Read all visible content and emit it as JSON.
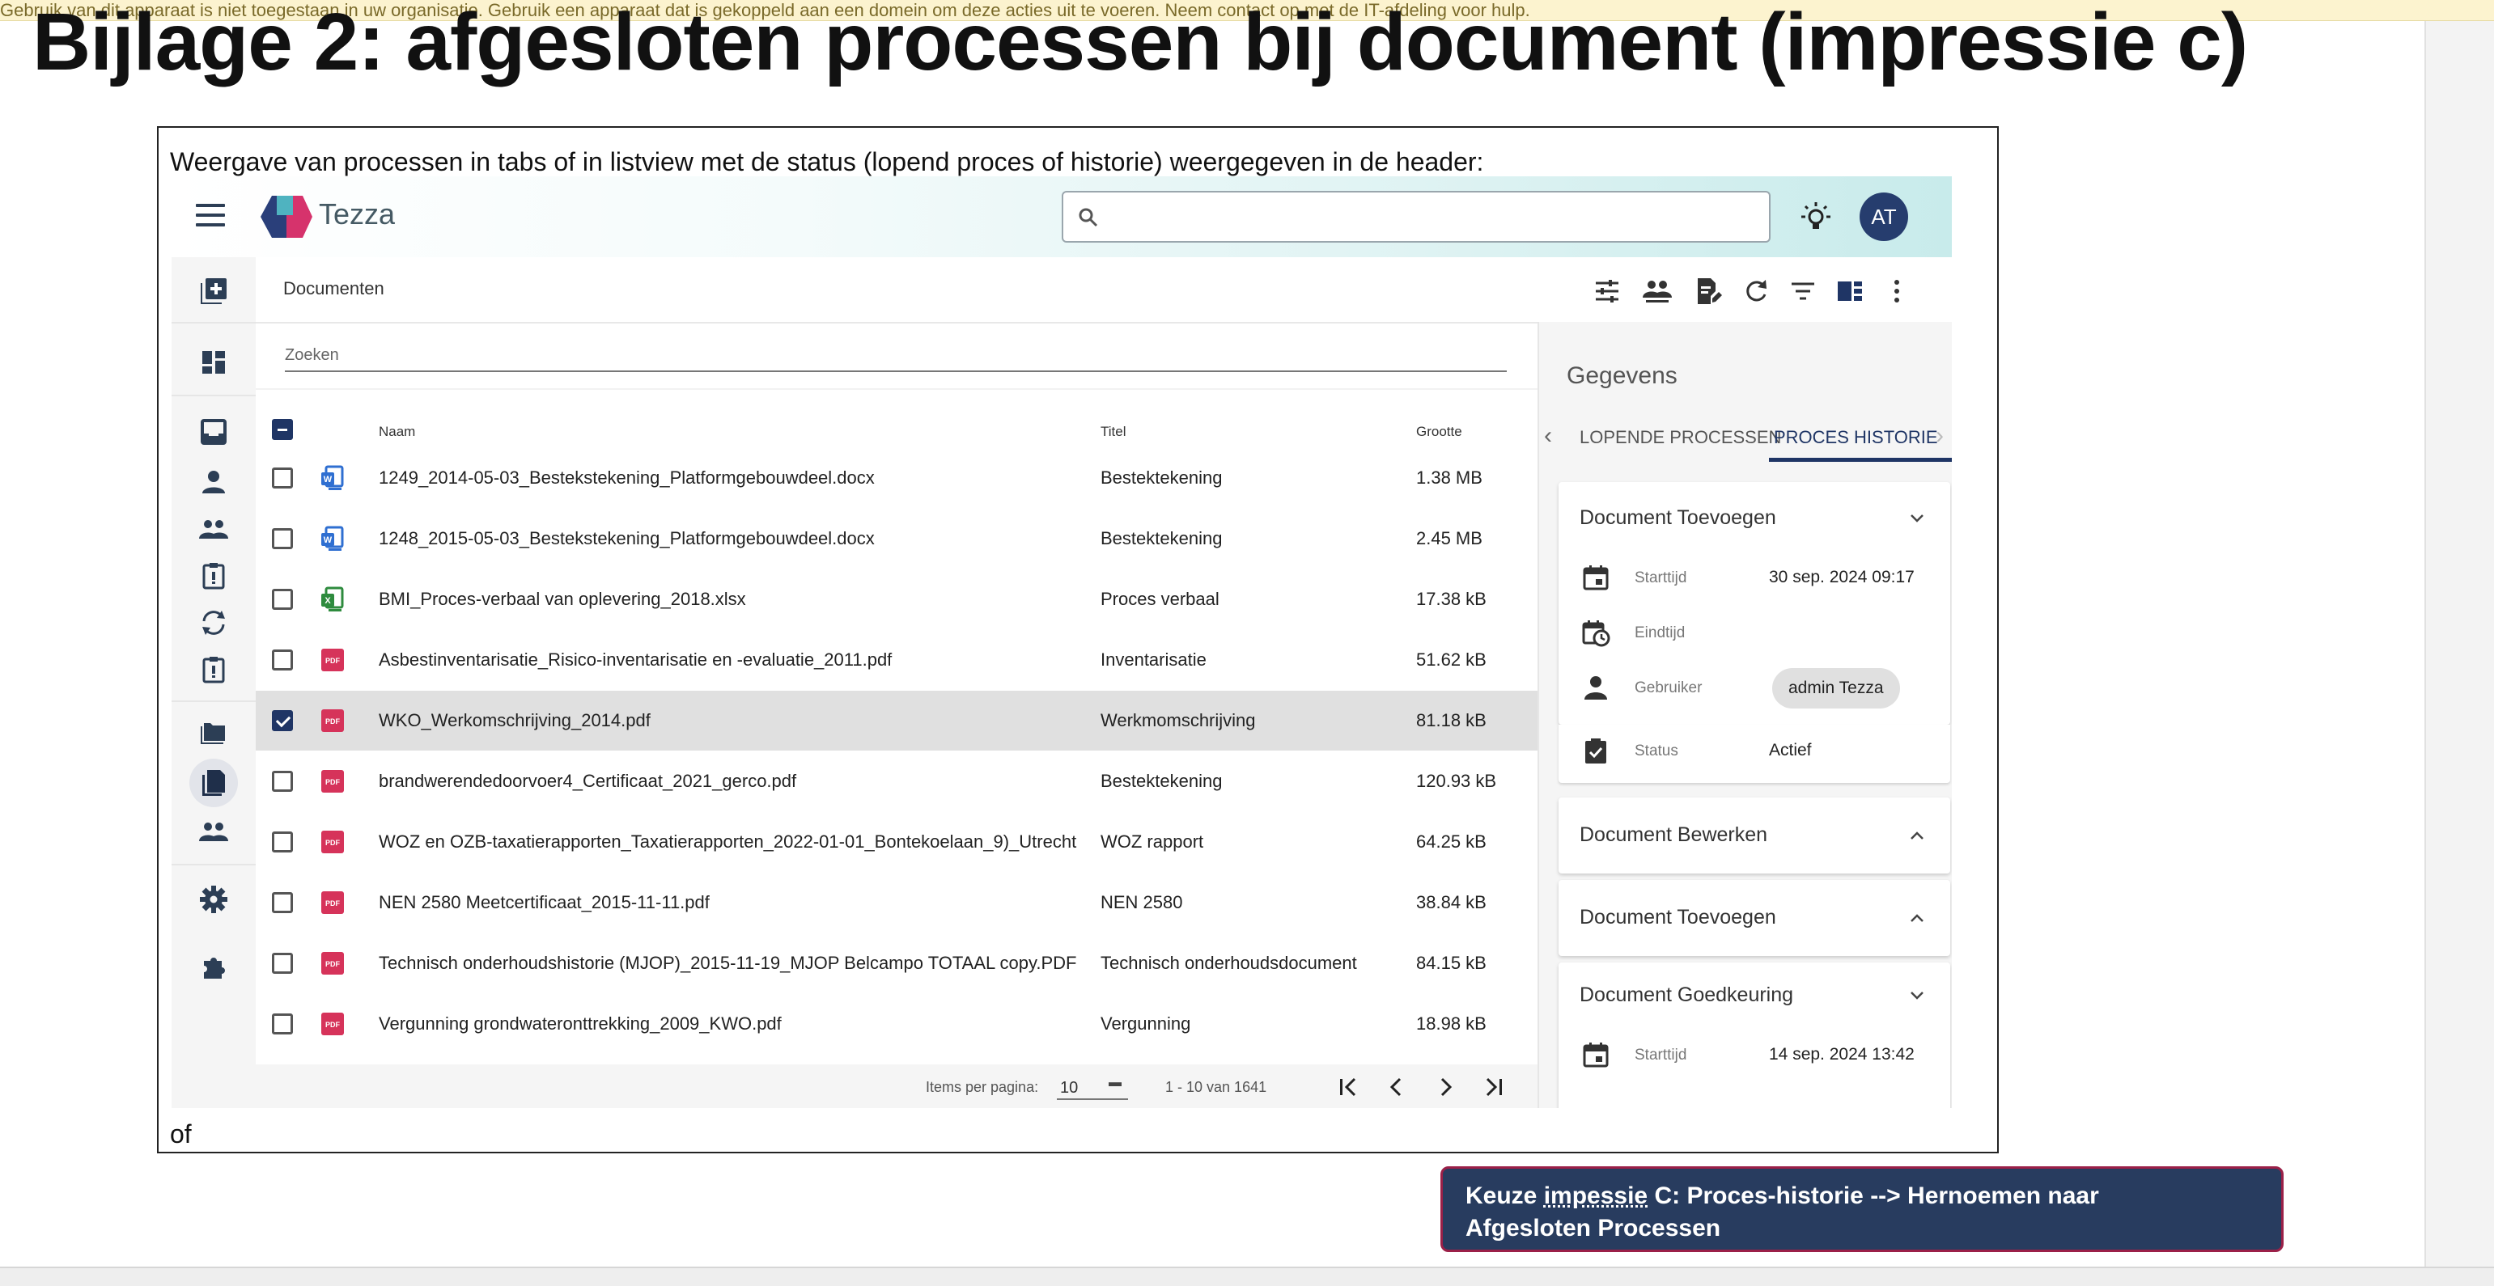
{
  "banner": {
    "text": "Gebruik van dit apparaat is niet toegestaan in uw organisatie. Gebruik een apparaat dat is gekoppeld aan een domein om deze acties uit te voeren. Neem contact op met de IT-afdeling voor hulp."
  },
  "page": {
    "heading": "Bijlage 2: afgesloten processen bij document (impressie c)",
    "intro": "Weergave van processen in tabs of in listview met de status (lopend proces of historie) weergegeven in de header:",
    "of": "of"
  },
  "app": {
    "brand": "Tezza",
    "avatar_initials": "AT",
    "accent_color": "#1f3565",
    "toolbar_title": "Documenten",
    "search_placeholder": "Zoeken",
    "columns": {
      "name": "Naam",
      "title": "Titel",
      "size": "Grootte"
    },
    "rows": [
      {
        "name": "1249_2014-05-03_Bestekstekening_Platformgebouwdeel.docx",
        "title": "Bestektekening",
        "size": "1.38 MB",
        "type": "docx",
        "checked": false
      },
      {
        "name": "1248_2015-05-03_Bestekstekening_Platformgebouwdeel.docx",
        "title": "Bestektekening",
        "size": "2.45 MB",
        "type": "docx",
        "checked": false
      },
      {
        "name": "BMI_Proces-verbaal van oplevering_2018.xlsx",
        "title": "Proces verbaal",
        "size": "17.38 kB",
        "type": "xlsx",
        "checked": false
      },
      {
        "name": "Asbestinventarisatie_Risico-inventarisatie en -evaluatie_2011.pdf",
        "title": "Inventarisatie",
        "size": "51.62 kB",
        "type": "pdf",
        "checked": false
      },
      {
        "name": "WKO_Werkomschrijving_2014.pdf",
        "title": "Werkmomschrijving",
        "size": "81.18 kB",
        "type": "pdf",
        "checked": true
      },
      {
        "name": "brandwerendedoorvoer4_Certificaat_2021_gerco.pdf",
        "title": "Bestektekening",
        "size": "120.93 kB",
        "type": "pdf",
        "checked": false
      },
      {
        "name": "WOZ en OZB-taxatierapporten_Taxatierapporten_2022-01-01_Bontekoelaan_9)_Utrecht",
        "title": "WOZ rapport",
        "size": "64.25 kB",
        "type": "pdf",
        "checked": false
      },
      {
        "name": "NEN 2580 Meetcertificaat_2015-11-11.pdf",
        "title": "NEN 2580",
        "size": "38.84 kB",
        "type": "pdf",
        "checked": false
      },
      {
        "name": "Technisch onderhoudshistorie (MJOP)_2015-11-19_MJOP Belcampo TOTAAL copy.PDF",
        "title": "Technisch onderhoudsdocument",
        "size": "84.15 kB",
        "type": "pdf",
        "checked": false
      },
      {
        "name": "Vergunning grondwateronttrekking_2009_KWO.pdf",
        "title": "Vergunning",
        "size": "18.98 kB",
        "type": "pdf",
        "checked": false
      }
    ],
    "paginator": {
      "label": "Items per pagina:",
      "value": "10",
      "range": "1 - 10 van 1641"
    },
    "details": {
      "title": "Gegevens",
      "tab_running": "LOPENDE PROCESSEN",
      "tab_history": "PROCES HISTORIE",
      "cards": [
        {
          "title": "Document Toevoegen",
          "expanded": true,
          "fields": [
            {
              "icon": "calendar-icon",
              "label": "Starttijd",
              "value": "30 sep. 2024 09:17"
            },
            {
              "icon": "calendar-clock-icon",
              "label": "Eindtijd",
              "value": ""
            },
            {
              "icon": "person-icon",
              "label": "Gebruiker",
              "value": "admin Tezza"
            },
            {
              "icon": "clipboard-check-icon",
              "label": "Status",
              "value": "Actief"
            }
          ]
        },
        {
          "title": "Document Bewerken",
          "expanded": false
        },
        {
          "title": "Document Toevoegen",
          "expanded": false
        },
        {
          "title": "Document Goedkeuring",
          "expanded": true,
          "fields": [
            {
              "icon": "calendar-icon",
              "label": "Starttijd",
              "value": "14 sep. 2024 13:42"
            }
          ]
        }
      ]
    }
  },
  "callout": {
    "line1_pre": "Keuze ",
    "line1_word": "impessie",
    "line1_post": " C: Proces-historie --> Hernoemen naar",
    "line2": "Afgesloten Processen"
  }
}
